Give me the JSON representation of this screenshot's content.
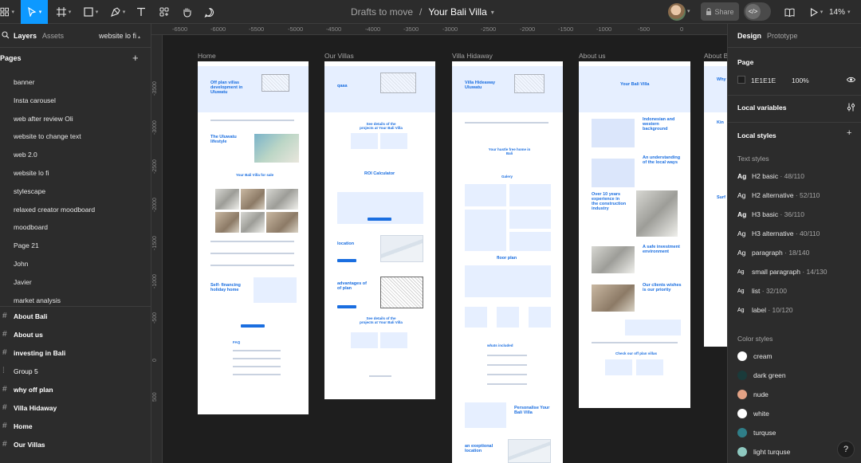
{
  "toolbar": {
    "file_location": "Drafts to move",
    "file_name": "Your Bali Villa",
    "share_label": "Share",
    "code_label": "</>",
    "zoom": "14%"
  },
  "left_panel": {
    "tab_layers": "Layers",
    "tab_assets": "Assets",
    "current_page": "website lo fi",
    "pages_header": "Pages",
    "pages": [
      "banner",
      "Insta carousel",
      "web after review Oli",
      "website to change text",
      "web 2.0",
      "website lo fi",
      "stylescape",
      "relaxed creator moodboard",
      "moodboard",
      "Page 21",
      "John",
      "Javier",
      "market analysis"
    ],
    "layers": [
      {
        "label": "About Bali",
        "kind": "frame"
      },
      {
        "label": "About us",
        "kind": "frame"
      },
      {
        "label": "investing in Bali",
        "kind": "frame"
      },
      {
        "label": "Group 5",
        "kind": "group"
      },
      {
        "label": "why off plan",
        "kind": "frame"
      },
      {
        "label": "Villa Hidaway",
        "kind": "frame"
      },
      {
        "label": "Home",
        "kind": "frame"
      },
      {
        "label": "Our Villas",
        "kind": "frame"
      }
    ]
  },
  "canvas": {
    "ruler_top": [
      "-6500",
      "-6000",
      "-5500",
      "-5000",
      "-4500",
      "-4000",
      "-3500",
      "-3000",
      "-2500",
      "-2000",
      "-1500",
      "-1000",
      "-500",
      "0"
    ],
    "ruler_left": [
      "-3500",
      "-3000",
      "-2500",
      "-2000",
      "-1500",
      "-1000",
      "-500",
      "0",
      "500"
    ],
    "frame_labels": [
      "Home",
      "Our Villas",
      "Villa Hidaway",
      "About us",
      "About B"
    ],
    "home": {
      "hero_title": "Off plan villas development in Uluwatu",
      "lifestyle_title": "The Uluwatu lifestyle",
      "villas_for_sale": "Your Bali Villa for sale",
      "financing_title": "Self- financing holiday home",
      "faq": "FAQ"
    },
    "villas": {
      "hero_word": "qaaa",
      "projects_title": "See details of the projects at Your Bali Villa",
      "roi_title": "ROI Calculator",
      "location_title": "location",
      "advantages_title": "advantages of of plan",
      "projects_title_2": "See details of the projects at Your Bali Villa"
    },
    "hidaway": {
      "hero_title": "Villa Hideaway Uluwatu",
      "home_title": "Your hustle free home in Bali",
      "gallery": "Galery",
      "floor_plan": "floor plan",
      "included": "whats included",
      "personalise": "Personalise Your Bali Villa",
      "location": "an exeptional location"
    },
    "about": {
      "hero_title": "Your Bali Villa",
      "t1": "Indonesian and western background",
      "t2": "An understanding of the local ways",
      "t3": "Over 10 years experience in the construction industry",
      "t4": "A safe investment environment",
      "t5": "Our clients wishes is our priority",
      "cta": "Check our off plan villas"
    },
    "about_bali": {
      "t1": "Why",
      "t2": "Kin",
      "t3": "Surf"
    }
  },
  "right_panel": {
    "tab_design": "Design",
    "tab_prototype": "Prototype",
    "page_title": "Page",
    "page_color": "1E1E1E",
    "page_opacity": "100%",
    "local_variables": "Local variables",
    "local_styles": "Local styles",
    "text_styles_title": "Text styles",
    "text_styles": [
      {
        "ag": "Ag",
        "name": "H2 basic",
        "meta": "48/110"
      },
      {
        "ag": "Ag",
        "name": "H2 alternative",
        "meta": "52/110"
      },
      {
        "ag": "Ag",
        "name": "H3 basic",
        "meta": "36/110"
      },
      {
        "ag": "Ag",
        "name": "H3 alternative",
        "meta": "40/110"
      },
      {
        "ag": "Ag",
        "name": "paragraph",
        "meta": "18/140"
      },
      {
        "ag": "Ag",
        "name": "small paragraph",
        "meta": "14/130"
      },
      {
        "ag": "Ag",
        "name": "list",
        "meta": "32/100"
      },
      {
        "ag": "Ag",
        "name": "label",
        "meta": "10/120"
      }
    ],
    "color_styles_title": "Color styles",
    "color_styles": [
      {
        "name": "cream",
        "color": "#ffffff"
      },
      {
        "name": "dark green",
        "color": "#1a3a3a"
      },
      {
        "name": "nude",
        "color": "#e3a285"
      },
      {
        "name": "white",
        "color": "#ffffff"
      },
      {
        "name": "turquse",
        "color": "#2f7e88"
      },
      {
        "name": "light turquse",
        "color": "#8fc9c0"
      }
    ],
    "help": "?"
  }
}
